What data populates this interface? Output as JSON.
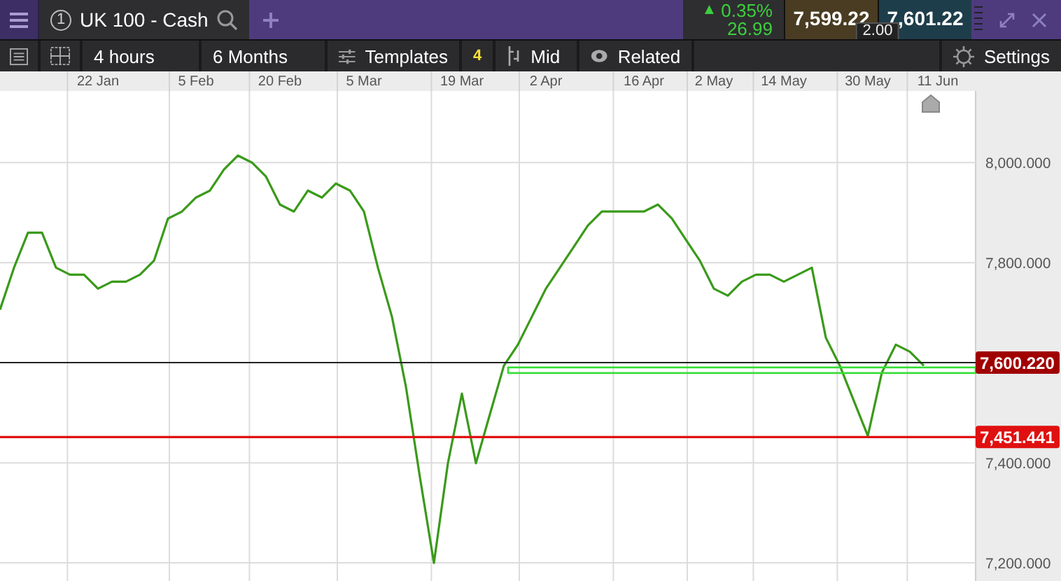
{
  "instrument_tab": {
    "number": "1",
    "name": "UK 100 - Cash"
  },
  "quote": {
    "arrow": "▲",
    "change_percent": "0.35%",
    "change": "26.99",
    "sell": "7,599.22",
    "buy": "7,601.22",
    "spread": "2.00"
  },
  "toolbar": {
    "interval": "4 hours",
    "range": "6 Months",
    "templates": "Templates",
    "templates_count": "4",
    "price_type": "Mid",
    "related": "Related",
    "settings": "Settings"
  },
  "chart_data": {
    "type": "line",
    "ylim": [
      7161,
      8143
    ],
    "grid": true,
    "categories": [
      null,
      null,
      null,
      null,
      null,
      null,
      null,
      "22 Jan",
      null,
      null,
      null,
      null,
      null,
      null,
      "5 Feb",
      null,
      null,
      null,
      null,
      null,
      "20 Feb",
      null,
      null,
      null,
      null,
      null,
      "5 Mar",
      null,
      null,
      null,
      null,
      null,
      null,
      "19 Mar",
      null,
      null,
      null,
      null,
      null,
      "2 Apr",
      null,
      null,
      null,
      null,
      null,
      null,
      "16 Apr",
      null,
      null,
      null,
      null,
      "2 May",
      null,
      null,
      null,
      null,
      "14 May",
      null,
      null,
      null,
      null,
      null,
      "30 May",
      null,
      null,
      null,
      null,
      "11 Jun",
      null,
      null
    ],
    "ref_lines": [
      {
        "axis": "y",
        "value": 7600.22,
        "color": "#222222"
      },
      {
        "axis": "y",
        "value": 7451.441,
        "color": "#e01010"
      }
    ],
    "yticks": [
      {
        "value": 8000,
        "label": "8,000.000"
      },
      {
        "value": 7800,
        "label": "7,800.000"
      },
      {
        "value": 7400,
        "label": "7,400.000"
      },
      {
        "value": 7200,
        "label": "7,200.000"
      }
    ],
    "series": [
      {
        "color": "#3a9a1a",
        "values": [
          7706,
          7790,
          7860,
          7860,
          7790,
          7776,
          7776,
          7748,
          7762,
          7762,
          7776,
          7804,
          7888,
          7902,
          7930,
          7944,
          7986,
          8014,
          8000,
          7972,
          7916,
          7902,
          7944,
          7930,
          7958,
          7944,
          7902,
          7790,
          7692,
          7552,
          7371,
          7200,
          7399,
          7538,
          7399,
          7497,
          7594,
          7636,
          7692,
          7748,
          7790,
          7832,
          7874,
          7902,
          7902,
          7902,
          7902,
          7916,
          7888,
          7846,
          7804,
          7748,
          7734,
          7762,
          7776,
          7776,
          7762,
          7776,
          7790,
          7650,
          7594,
          7524,
          7454,
          7580,
          7636,
          7622,
          7594,
          null,
          null,
          null
        ]
      }
    ]
  },
  "price_levels": [
    {
      "value": "7,600.220",
      "color": "#a00000"
    },
    {
      "value": "7,451.441",
      "color": "#e01010"
    }
  ]
}
